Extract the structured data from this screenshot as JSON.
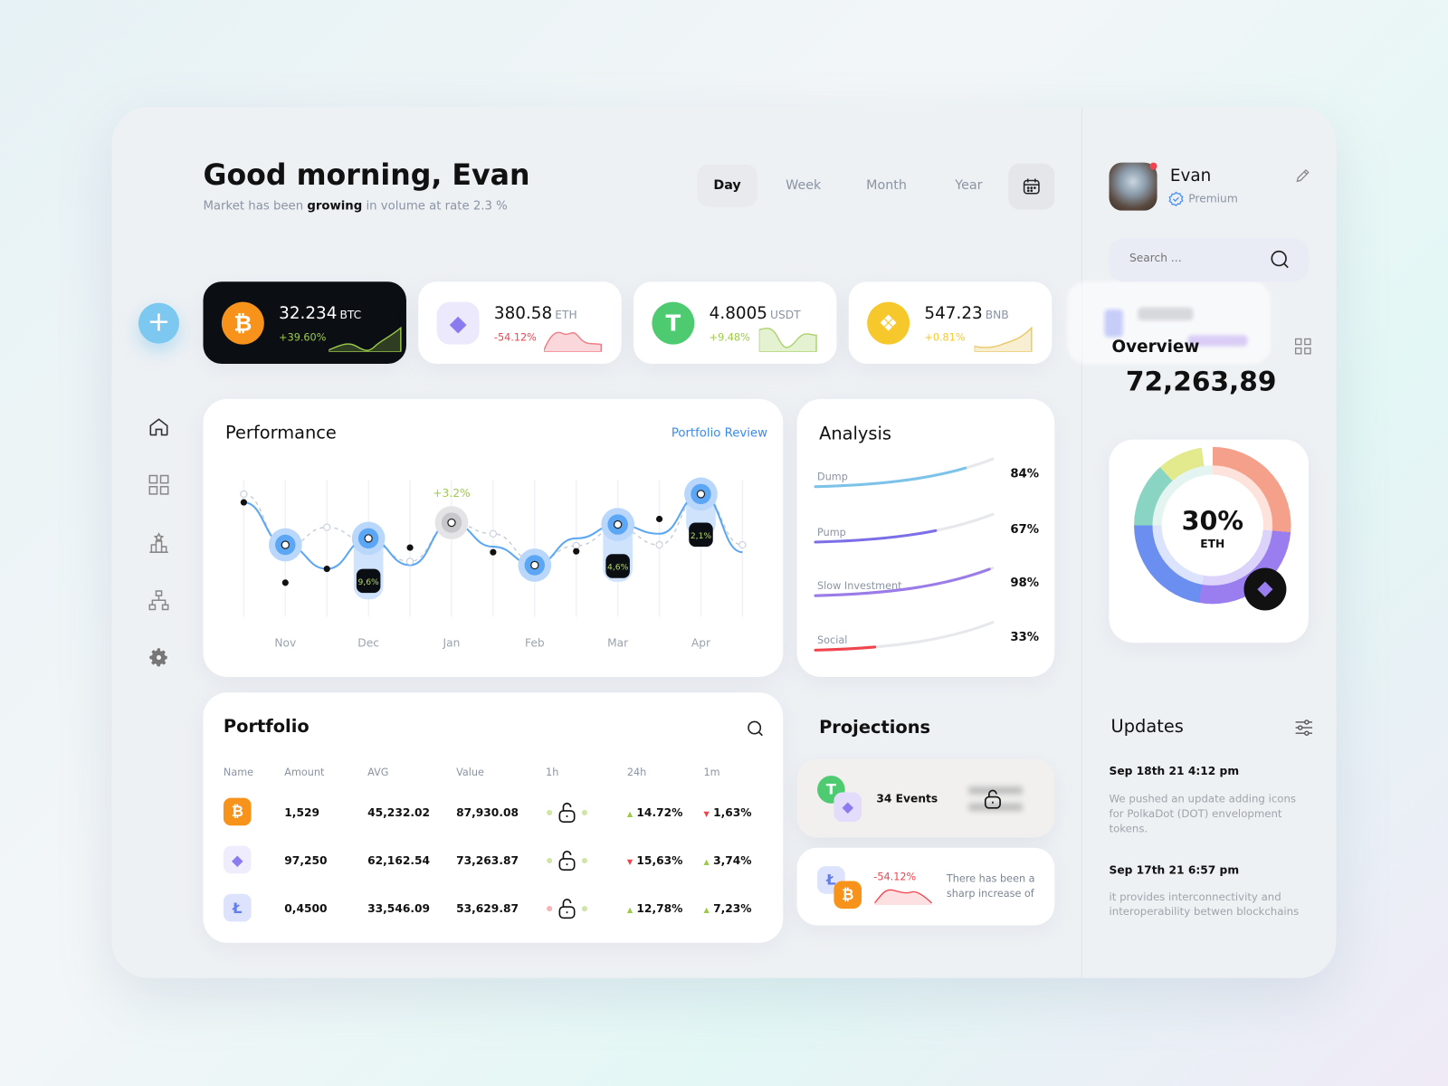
{
  "header": {
    "greeting": "Good morning, Evan",
    "subtitle_pre": "Market has been ",
    "subtitle_bold": "growing",
    "subtitle_post": " in volume at rate 2.3 %",
    "tabs": [
      {
        "label": "Day",
        "active": true
      },
      {
        "label": "Week"
      },
      {
        "label": "Month"
      },
      {
        "label": "Year"
      }
    ]
  },
  "sidebar": {
    "items": [
      "add",
      "home",
      "dashboard",
      "rewards",
      "network",
      "settings"
    ]
  },
  "coins": [
    {
      "value": "32.234",
      "symbol": "BTC",
      "change": "+39.60%",
      "color": "#f7931a",
      "change_color": "#9ccb4a"
    },
    {
      "value": "380.58",
      "symbol": "ETH",
      "change": "-54.12%",
      "color": "#8a7cf0",
      "change_color": "#f0444e"
    },
    {
      "value": "4.8005",
      "symbol": "USDT",
      "change": "+9.48%",
      "color": "#4ecb71",
      "change_color": "#9ccb4a"
    },
    {
      "value": "547.23",
      "symbol": "BNB",
      "change": "+0.81%",
      "color": "#f7c82c",
      "change_color": "#f7c82c"
    }
  ],
  "performance": {
    "title": "Performance",
    "link": "Portfolio Review"
  },
  "chart_data": {
    "type": "line",
    "categories": [
      "Nov",
      "Dec",
      "Jan",
      "Feb",
      "Mar",
      "Apr"
    ],
    "annotations": [
      {
        "x": "Dec",
        "label": "9,6%"
      },
      {
        "x": "Jan",
        "label": "+3.2%"
      },
      {
        "x": "Mar",
        "label": "4,6%"
      },
      {
        "x": "Apr",
        "label": "2,1%"
      }
    ],
    "grid": "vertical"
  },
  "analysis": {
    "title": "Analysis",
    "rows": [
      {
        "label": "Dump",
        "pct": "84%",
        "value": 0.84,
        "color": "#7cc3ea"
      },
      {
        "label": "Pump",
        "pct": "67%",
        "value": 0.67,
        "color": "#7b6ee8"
      },
      {
        "label": "Slow Investment",
        "pct": "98%",
        "value": 0.98,
        "color": "#9b7be8"
      },
      {
        "label": "Social",
        "pct": "33%",
        "value": 0.33,
        "color": "#f0444e"
      }
    ]
  },
  "portfolio": {
    "title": "Portfolio",
    "columns": [
      "Name",
      "Amount",
      "AVG",
      "Value",
      "1h",
      "24h",
      "1m"
    ],
    "rows": [
      {
        "coin": "BTC",
        "amount": "1,529",
        "avg": "45,232.02",
        "value": "87,930.08",
        "d24": "14.72%",
        "d24_up": true,
        "m1": "1,63%",
        "m1_up": false
      },
      {
        "coin": "ETH",
        "amount": "97,250",
        "avg": "62,162.54",
        "value": "73,263.87",
        "d24": "15,63%",
        "d24_up": false,
        "m1": "3,74%",
        "m1_up": true
      },
      {
        "coin": "LTC",
        "amount": "0,4500",
        "avg": "33,546.09",
        "value": "53,629.87",
        "d24": "12,78%",
        "d24_up": true,
        "m1": "7,23%",
        "m1_up": true
      }
    ]
  },
  "projections": {
    "title": "Projections",
    "events": "34 Events",
    "change": "-54.12%",
    "text1": "There has been a",
    "text2": "sharp increase of"
  },
  "profile": {
    "name": "Evan",
    "tier": "Premium"
  },
  "search": {
    "placeholder": "Search ..."
  },
  "overview": {
    "title": "Overview",
    "value": "72,263,89",
    "donut_pct": "30%",
    "donut_unit": "ETH"
  },
  "updates": {
    "title": "Updates",
    "items": [
      {
        "date": "Sep  18th 21   4:12 pm",
        "text": "We pushed an update adding icons for PolkaDot (DOT) envelopment tokens."
      },
      {
        "date": "Sep  17th 21   6:57 pm",
        "text": "it provides interconnectivity and interoperability betwen blockchains"
      }
    ]
  }
}
